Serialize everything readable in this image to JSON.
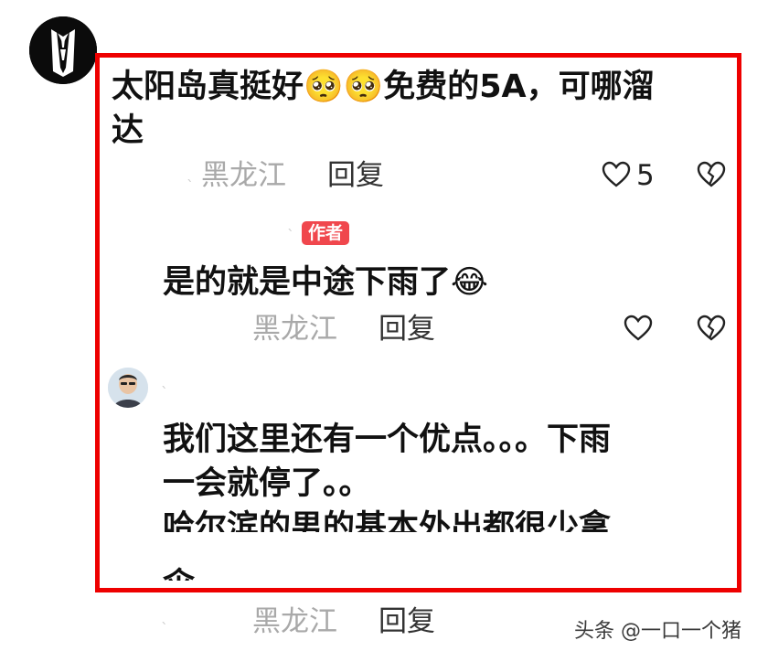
{
  "comment1": {
    "text_line1": "太阳岛真挺好",
    "emoji": [
      "🥺",
      "🥺"
    ],
    "text_line1_tail": "免费的5A，可哪溜",
    "text_line2": "达",
    "location": "黑龙江",
    "reply_label": "回复",
    "like_count": "5",
    "icons": [
      "heart-outline-icon",
      "broken-heart-icon"
    ]
  },
  "reply1": {
    "badge": "作者",
    "text": "是的就是中途下雨了",
    "emoji": "😂",
    "location": "黑龙江",
    "reply_label": "回复",
    "icons": [
      "heart-outline-icon",
      "broken-heart-icon"
    ]
  },
  "reply2": {
    "lines": [
      "我们这里还有一个优点。。。下雨",
      "一会就停了。。",
      "哈尔滨的男的基本外出都很少拿",
      "伞。。"
    ],
    "location": "黑龙江",
    "reply_label": "回复"
  },
  "watermark": {
    "text": "头条 @一口一个猪"
  },
  "colors": {
    "highlight_border": "#ee0000",
    "badge_bg": "#f0474d",
    "location_text": "#a9a9a9"
  }
}
